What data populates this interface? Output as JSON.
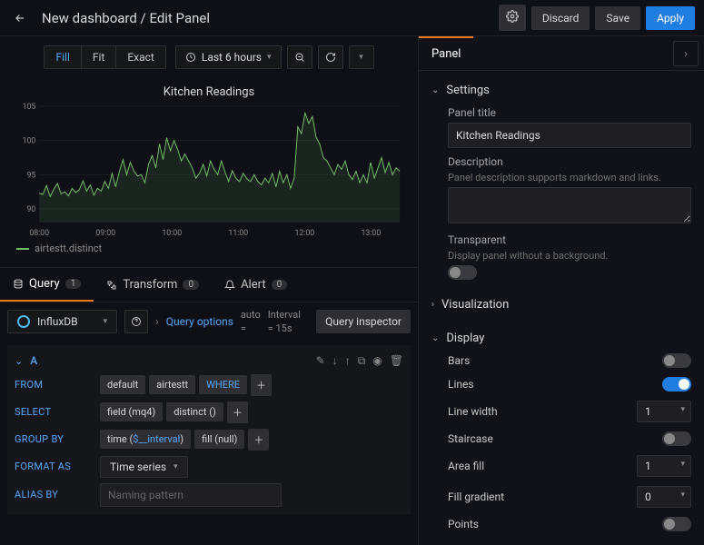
{
  "header": {
    "title": "New dashboard / Edit Panel",
    "discard": "Discard",
    "save": "Save",
    "apply": "Apply"
  },
  "view": {
    "seg": [
      "Fill",
      "Fit",
      "Exact"
    ],
    "active": 0,
    "timerange": "Last 6 hours"
  },
  "chart_data": {
    "type": "line",
    "title": "Kitchen Readings",
    "series": [
      {
        "name": "airtestt.distinct"
      }
    ],
    "ylim": [
      88,
      105
    ],
    "yticks": [
      90,
      95,
      100,
      105
    ],
    "xticks": [
      "08:00",
      "09:00",
      "10:00",
      "11:00",
      "12:00",
      "13:00"
    ],
    "values": [
      92.3,
      92.1,
      93.4,
      91.8,
      92.9,
      93.7,
      92.2,
      92.5,
      91.9,
      93.0,
      92.4,
      92.8,
      94.1,
      92.6,
      93.5,
      92.0,
      93.0,
      92.6,
      94.0,
      93.0,
      95.2,
      93.2,
      95.5,
      97.2,
      95.0,
      96.8,
      95.5,
      94.8,
      95.0,
      93.8,
      96.5,
      97.8,
      96.0,
      99.5,
      97.2,
      100.4,
      98.5,
      100.0,
      98.7,
      97.0,
      98.0,
      97.0,
      96.0,
      94.5,
      95.2,
      96.5,
      94.8,
      97.0,
      95.8,
      95.0,
      97.0,
      95.4,
      94.0,
      95.6,
      94.5,
      94.0,
      95.2,
      94.4,
      94.0,
      95.0,
      94.0,
      93.5,
      94.5,
      93.8,
      95.2,
      93.2,
      95.5,
      93.8,
      95.0,
      93.0,
      94.5,
      102.0,
      101.0,
      104.0,
      102.5,
      103.5,
      100.5,
      99.5,
      97.5,
      97.0,
      96.0,
      95.0,
      96.5,
      95.8,
      97.0,
      95.0,
      94.3,
      95.5,
      93.8,
      95.0,
      93.8,
      96.8,
      94.5,
      96.0,
      97.5,
      95.3,
      96.8,
      95.0,
      96.0,
      95.5
    ]
  },
  "qtabs": {
    "query": "Query",
    "query_count": "1",
    "transform": "Transform",
    "transform_count": "0",
    "alert": "Alert",
    "alert_count": "0"
  },
  "ds": {
    "name": "InfluxDB",
    "qopts": "Query options",
    "interval_lbl": "Interval",
    "auto": "auto",
    "interval_val": "= 15s",
    "inspector": "Query inspector"
  },
  "qA": {
    "name": "A",
    "from": "FROM",
    "from_default": "default",
    "from_meas": "airtestt",
    "where": "WHERE",
    "select": "SELECT",
    "select_field": "field (mq4)",
    "select_agg": "distinct ()",
    "groupby": "GROUP BY",
    "gb_time": "time ($__interval)",
    "gb_time_pre": "time (",
    "gb_time_param": "$__interval",
    "gb_time_post": ")",
    "gb_fill": "fill (null)",
    "formatas": "FORMAT AS",
    "format_val": "Time series",
    "aliasby": "ALIAS BY",
    "alias_ph": "Naming pattern"
  },
  "rpanel": {
    "tab": "Panel",
    "settings": "Settings",
    "title_lbl": "Panel title",
    "title_val": "Kitchen Readings",
    "desc_lbl": "Description",
    "desc_hint": "Panel description supports markdown and links.",
    "transparent_lbl": "Transparent",
    "transparent_hint": "Display panel without a background.",
    "viz": "Visualization",
    "display": "Display",
    "dopts": {
      "bars": "Bars",
      "lines": "Lines",
      "linewidth": "Line width",
      "linewidth_v": "1",
      "staircase": "Staircase",
      "areafill": "Area fill",
      "areafill_v": "1",
      "fillgrad": "Fill gradient",
      "fillgrad_v": "0",
      "points": "Points"
    }
  }
}
